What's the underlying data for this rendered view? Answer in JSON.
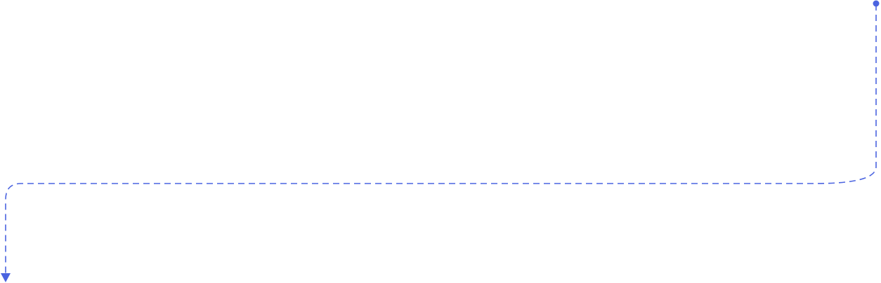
{
  "diagram": {
    "connector": {
      "style": "dashed",
      "color": "#4a63e0",
      "start_marker": "dot",
      "end_marker": "arrowhead"
    }
  }
}
